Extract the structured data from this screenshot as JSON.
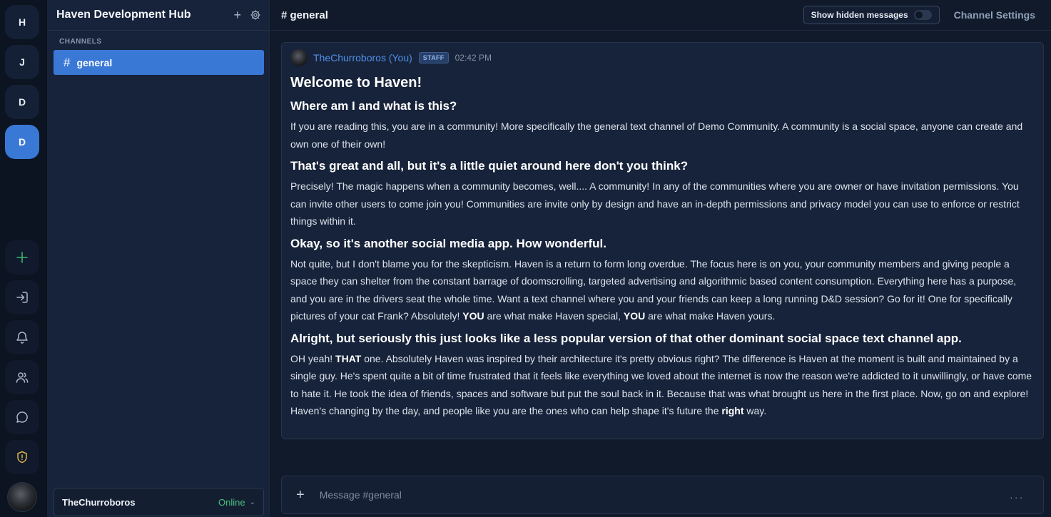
{
  "rail": {
    "servers": [
      {
        "label": "H",
        "active": false
      },
      {
        "label": "J",
        "active": false
      },
      {
        "label": "D",
        "active": false
      },
      {
        "label": "D",
        "active": true
      }
    ],
    "actions": [
      "add-server-icon",
      "join-icon",
      "bell-icon",
      "friends-icon",
      "chat-icon",
      "shield-icon"
    ],
    "accent": "#3a78d6"
  },
  "sidebar": {
    "title": "Haven Development Hub",
    "add_label": "+",
    "section_label": "CHANNELS",
    "channels": [
      {
        "hash": "#",
        "name": "general",
        "active": true
      }
    ],
    "user": {
      "name": "TheChurroboros",
      "status": "Online",
      "status_color": "#4ac07f"
    }
  },
  "header": {
    "channel": "# general",
    "hidden_messages_label": "Show hidden messages",
    "hidden_messages_on": false,
    "settings_label": "Channel Settings"
  },
  "message": {
    "author": "TheChurroboros (You)",
    "badge": "STAFF",
    "time": "02:42 PM",
    "title": "Welcome to Haven!",
    "sections": [
      {
        "heading": "Where am I and what is this?",
        "text": "If you are reading this, you are in a community! More specifically the general text channel of Demo Community. A community is a social space, anyone can create and own one of their own!"
      },
      {
        "heading": "That's great and all, but it's a little quiet around here don't you think?",
        "text": "Precisely! The magic happens when a community becomes, well.... A community! In any of the communities where you are owner or have invitation permissions. You can invite other users to come join you! Communities are invite only by design and have an in-depth permissions and privacy model you can use to enforce or restrict things within it."
      },
      {
        "heading": "Okay, so it's another social media app. How wonderful.",
        "text_a": "Not quite, but I don't blame you for the skepticism. Haven is a return to form long overdue. The focus here is on you, your community members and giving people a space they can shelter from the constant barrage of doomscrolling, targeted advertising and algorithmic based content consumption. Everything here has a purpose, and you are in the drivers seat the whole time. Want a text channel where you and your friends can keep a long running D&D session? Go for it! One for specifically pictures of your cat Frank? Absolutely! ",
        "bold_1": "YOU",
        "text_b": " are what make Haven special, ",
        "bold_2": "YOU",
        "text_c": " are what make Haven yours."
      },
      {
        "heading": "Alright, but seriously this just looks like a less popular version of that other dominant social space text channel app.",
        "text_a": "OH yeah! ",
        "bold_1": "THAT",
        "text_b": " one. Absolutely Haven was inspired by their architecture it's pretty obvious right? The difference is Haven at the moment is built and maintained by a single guy. He's spent quite a bit of time frustrated that it feels like everything we loved about the internet is now the reason we're addicted to it unwillingly, or have come to hate it. He took the idea of friends, spaces and software but put the soul back in it. Because that was what brought us here in the first place. Now, go on and explore! Haven's changing by the day, and people like you are the ones who can help shape it's future the ",
        "bold_2": "right",
        "text_c": " way."
      }
    ]
  },
  "composer": {
    "plus": "+",
    "placeholder": "Message #general",
    "more": "..."
  }
}
